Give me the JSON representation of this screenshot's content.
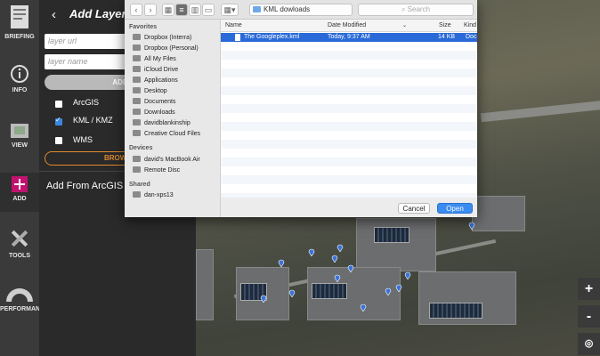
{
  "rail": {
    "items": [
      {
        "label": "BRIEFING"
      },
      {
        "label": "INFO"
      },
      {
        "label": "VIEW"
      },
      {
        "label": "ADD"
      },
      {
        "label": "TOOLS"
      },
      {
        "label": "PERFORMANCE"
      }
    ]
  },
  "panel": {
    "title": "Add Layer",
    "layer_url_placeholder": "layer url",
    "layer_name_placeholder": "layer name",
    "add_button": "ADD",
    "options": [
      {
        "label": "ArcGIS",
        "checked": false
      },
      {
        "label": "KML / KMZ",
        "checked": true
      },
      {
        "label": "WMS",
        "checked": false
      }
    ],
    "browse_button": "BROWSE",
    "arcgis_heading": "Add From ArcGIS O"
  },
  "dialog": {
    "path": "KML dowloads",
    "search_placeholder": "Search",
    "sidebar": {
      "favorites_heading": "Favorites",
      "favorites": [
        "Dropbox (Interra)",
        "Dropbox (Personal)",
        "All My Files",
        "iCloud Drive",
        "Applications",
        "Desktop",
        "Documents",
        "Downloads",
        "davidblankinship",
        "Creative Cloud Files"
      ],
      "devices_heading": "Devices",
      "devices": [
        "david's MacBook Air",
        "Remote Disc"
      ],
      "shared_heading": "Shared",
      "shared": [
        "dan-xps13"
      ]
    },
    "columns": {
      "name": "Name",
      "date": "Date Modified",
      "size": "Size",
      "kind": "Kind"
    },
    "files": [
      {
        "name": "The Googleplex.kml",
        "date": "Today, 9:37 AM",
        "size": "14 KB",
        "kind": "Doc"
      }
    ],
    "cancel_button": "Cancel",
    "open_button": "Open"
  },
  "map": {
    "zoom_in": "+",
    "zoom_out": "-",
    "locate": "◎"
  }
}
